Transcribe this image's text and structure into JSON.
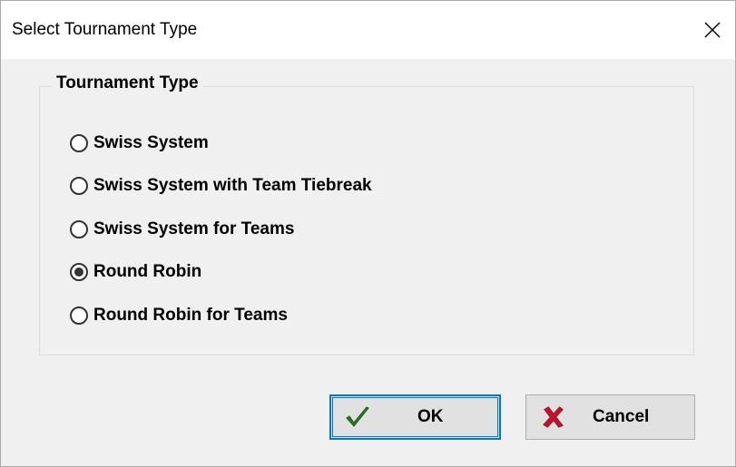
{
  "window": {
    "title": "Select Tournament Type"
  },
  "group": {
    "legend": "Tournament Type",
    "options": [
      {
        "label": "Swiss System",
        "checked": false
      },
      {
        "label": "Swiss System with Team Tiebreak",
        "checked": false
      },
      {
        "label": "Swiss System for Teams",
        "checked": false
      },
      {
        "label": "Round Robin",
        "checked": true
      },
      {
        "label": "Round Robin for Teams",
        "checked": false
      }
    ]
  },
  "buttons": {
    "ok_label": "OK",
    "ok_icon": "checkmark-icon",
    "cancel_label": "Cancel",
    "cancel_icon": "red-x-icon"
  },
  "colors": {
    "focus_border": "#0078d7",
    "ok_icon": "#2a7d1c",
    "cancel_icon": "#c8102e"
  }
}
